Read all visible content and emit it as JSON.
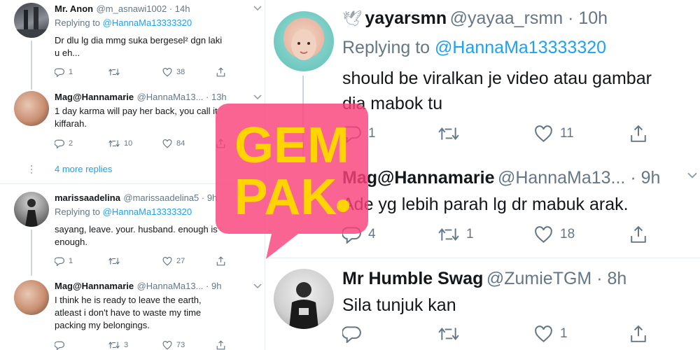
{
  "left_tweets": [
    {
      "name": "Mr. Anon",
      "handle": "@m_asnawi1002 · 14h",
      "reply_prefix": "Replying to ",
      "reply_to": "@HannaMa13333320",
      "body": [
        "Dr dlu lg dia mmg suka bergesel² dgn laki",
        "u eh..."
      ],
      "counts": {
        "reply": "1",
        "retweet": "",
        "like": "38"
      }
    },
    {
      "name": "Mag@Hannamarie",
      "handle": "@HannaMa13... · 13h",
      "body": [
        "1 day karma will pay her back, you call it",
        "kiffarah."
      ],
      "counts": {
        "reply": "2",
        "retweet": "10",
        "like": "84"
      }
    },
    {
      "name": "marissaadelina",
      "handle": "@marissaadelina5 · 9h",
      "reply_prefix": "Replying to ",
      "reply_to": "@HannaMa13333320",
      "body": [
        "sayang, leave. your. husband. enough is",
        "enough."
      ],
      "counts": {
        "reply": "1",
        "retweet": "",
        "like": "27"
      }
    },
    {
      "name": "Mag@Hannamarie",
      "handle": "@HannaMa13... · 9h",
      "body": [
        "I think he is ready to leave the earth,",
        "atleast i don't have to waste my time",
        "packing my belongings."
      ],
      "counts": {
        "reply": "",
        "retweet": "3",
        "like": "73"
      }
    }
  ],
  "more_replies": "4 more replies",
  "right_tweets": [
    {
      "name": "yayarsmn",
      "handle": "@yayaa_rsmn · 10h",
      "reply_prefix": "Replying to ",
      "reply_to": "@HannaMa13333320",
      "body": [
        "should be viralkan je video atau gambar",
        "dia mabok tu"
      ],
      "counts": {
        "reply": "1",
        "retweet": "",
        "like": "11"
      }
    },
    {
      "name": "Mag@Hannamarie",
      "handle": "@HannaMa13... · 9h",
      "body": [
        "Ade yg lebih parah lg dr mabuk arak."
      ],
      "counts": {
        "reply": "4",
        "retweet": "1",
        "like": "18"
      }
    },
    {
      "name": "Mr Humble Swag",
      "handle": "@ZumieTGM · 8h",
      "body": [
        "Sila tunjuk kan"
      ],
      "counts": {
        "reply": "",
        "retweet": "",
        "like": "1"
      }
    }
  ],
  "watermark": {
    "line1": "GEM",
    "line2": "PAK",
    "color": "#f9427a",
    "text_color": "#ffd400"
  },
  "colors": {
    "link": "#1da1f2",
    "muted": "#657786",
    "divider": "#e6ecf0"
  },
  "icons": [
    "reply-icon",
    "retweet-icon",
    "like-icon",
    "share-icon",
    "chevron-down-icon",
    "dove-emoji-icon"
  ]
}
